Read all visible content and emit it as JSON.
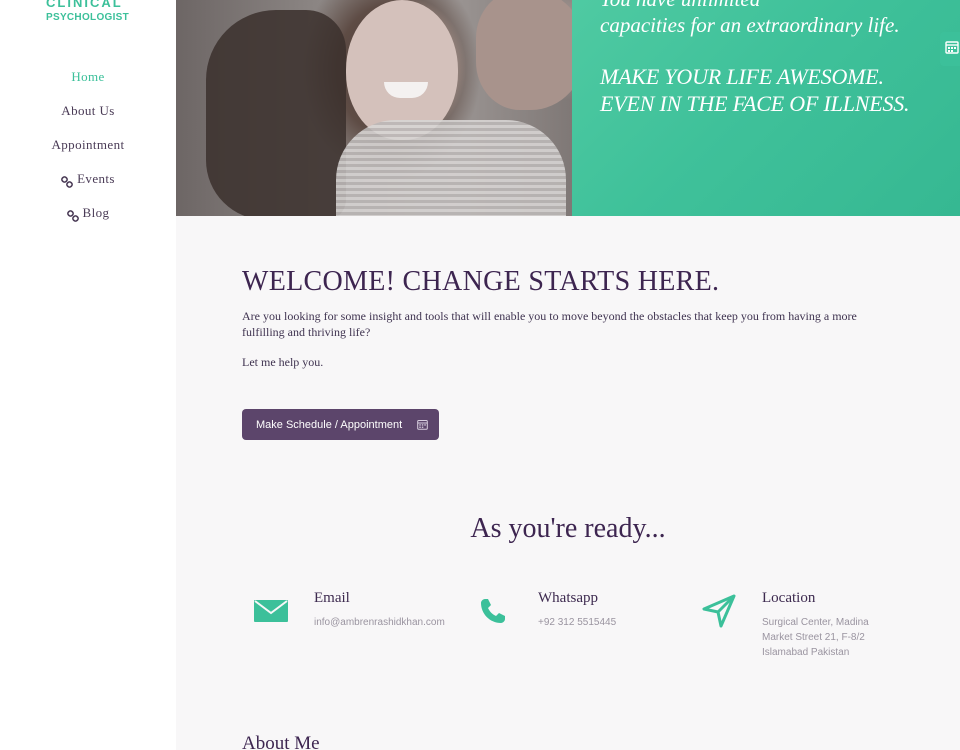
{
  "logo": {
    "line1": "CLINICAL",
    "line2": "PSYCHOLOGIST"
  },
  "nav": [
    {
      "label": "Home",
      "active": true
    },
    {
      "label": "About Us"
    },
    {
      "label": "Appointment"
    },
    {
      "label": "Events",
      "icon": "link-icon"
    },
    {
      "label": "Blog",
      "icon": "link-icon"
    }
  ],
  "hero": {
    "quote_line1": "You have unlimited",
    "quote_line2": "capacities for an extraordinary life.",
    "headline_line1": "MAKE YOUR LIFE AWESOME.",
    "headline_line2": "EVEN IN THE FACE OF ILLNESS.",
    "accent_color": "#3cc09a"
  },
  "welcome": {
    "title": "WELCOME! CHANGE STARTS HERE.",
    "intro": "Are you looking for some insight and tools that will enable you to move beyond the obstacles that keep you from having a more fulfilling and thriving life?",
    "help": "Let me help you.",
    "button_label": "Make Schedule / Appointment"
  },
  "ready": {
    "title": "As you're ready..."
  },
  "contacts": [
    {
      "icon": "envelope-icon",
      "title": "Email",
      "lines": [
        "info@ambrenrashidkhan.com"
      ]
    },
    {
      "icon": "phone-icon",
      "title": "Whatsapp",
      "lines": [
        "+92 312 5515445"
      ]
    },
    {
      "icon": "location-arrow-icon",
      "title": "Location",
      "lines": [
        "Surgical Center, Madina",
        "Market Street 21, F-8/2",
        "Islamabad Pakistan"
      ]
    }
  ],
  "about": {
    "title": "About Me"
  },
  "colors": {
    "primary": "#5c456b",
    "accent": "#3cc09a",
    "heading": "#3d2550"
  }
}
